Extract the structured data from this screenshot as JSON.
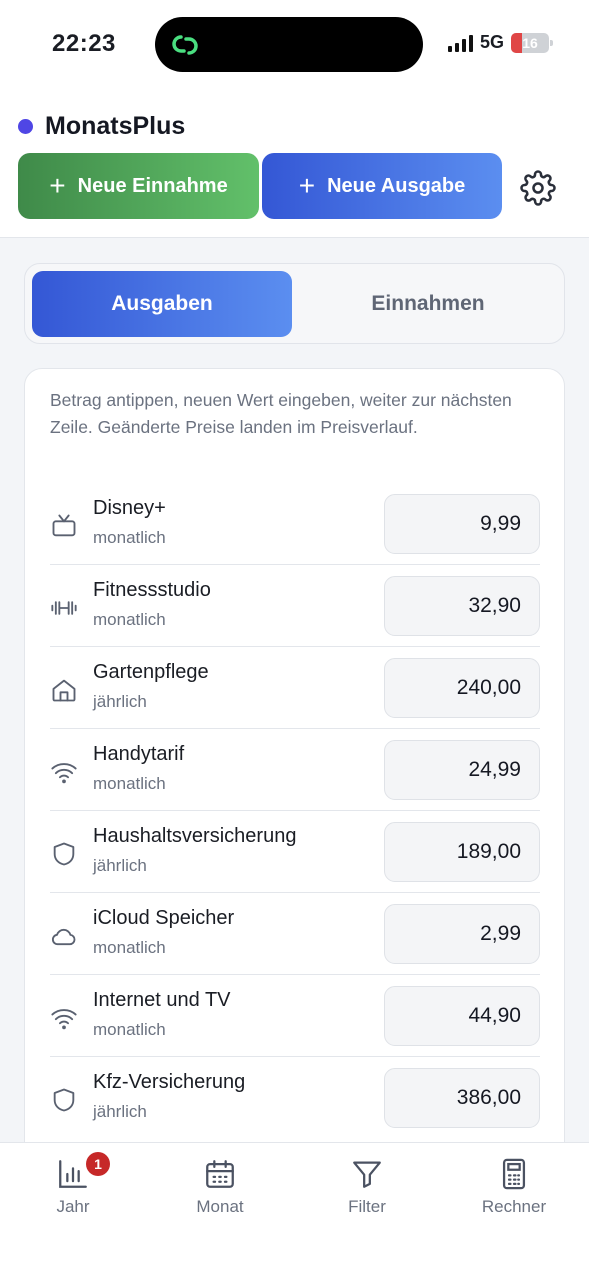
{
  "status_bar": {
    "time": "22:23",
    "network": "5G",
    "battery": "16"
  },
  "app": {
    "name": "MonatsPlus",
    "brand_color": "#4f46e5"
  },
  "actions": {
    "new_income": "Neue Einnahme",
    "new_expense": "Neue Ausgabe",
    "plus_glyph": "+"
  },
  "segments": {
    "active": "Ausgaben",
    "inactive": "Einnahmen"
  },
  "hint": "Betrag antippen, neuen Wert eingeben, weiter zur nächsten Zeile. Geänderte Preise landen im Preisverlauf.",
  "items": [
    {
      "name": "Disney+",
      "period": "monatlich",
      "amount": "9,99",
      "icon": "tv-icon"
    },
    {
      "name": "Fitnessstudio",
      "period": "monatlich",
      "amount": "32,90",
      "icon": "dumbbell-icon"
    },
    {
      "name": "Gartenpflege",
      "period": "jährlich",
      "amount": "240,00",
      "icon": "home-icon"
    },
    {
      "name": "Handytarif",
      "period": "monatlich",
      "amount": "24,99",
      "icon": "wifi-icon"
    },
    {
      "name": "Haushaltsversicherung",
      "period": "jährlich",
      "amount": "189,00",
      "icon": "shield-icon"
    },
    {
      "name": "iCloud Speicher",
      "period": "monatlich",
      "amount": "2,99",
      "icon": "cloud-icon"
    },
    {
      "name": "Internet und TV",
      "period": "monatlich",
      "amount": "44,90",
      "icon": "wifi-icon"
    },
    {
      "name": "Kfz-Versicherung",
      "period": "jährlich",
      "amount": "386,00",
      "icon": "shield-icon"
    }
  ],
  "tabbar": {
    "tabs": [
      {
        "label": "Jahr",
        "icon": "bar-chart-icon",
        "badge": "1"
      },
      {
        "label": "Monat",
        "icon": "calendar-icon"
      },
      {
        "label": "Filter",
        "icon": "filter-icon"
      },
      {
        "label": "Rechner",
        "icon": "calculator-icon"
      }
    ]
  },
  "colors": {
    "income_green": "#4caf50",
    "expense_blue": "#3b6ee0",
    "badge_red": "#c62828"
  }
}
